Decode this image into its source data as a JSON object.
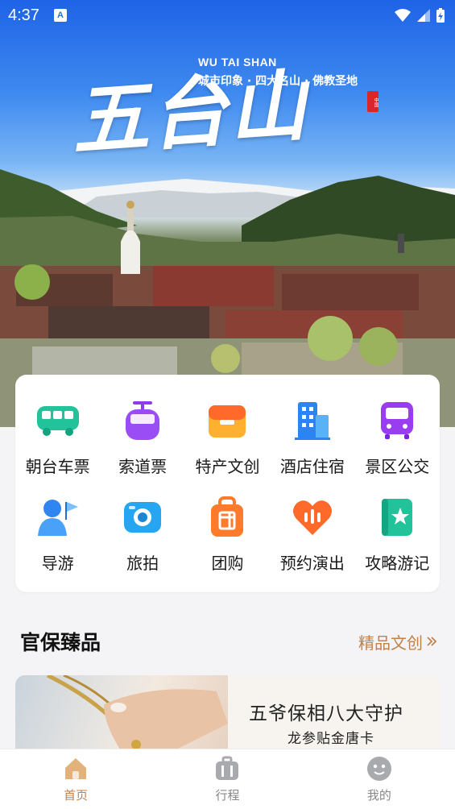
{
  "status_bar": {
    "time": "4:37",
    "notification_badge": "A"
  },
  "hero": {
    "title": "五台山",
    "english_title": "WU TAI SHAN",
    "subtitle": "城市印象 · 四大名山 · 佛教圣地",
    "seal_text": "中国"
  },
  "services": [
    {
      "label": "朝台车票",
      "icon": "bus-icon",
      "color": "#22c39a"
    },
    {
      "label": "索道票",
      "icon": "cable-car-icon",
      "color": "#8b3cf0"
    },
    {
      "label": "特产文创",
      "icon": "gift-box-icon",
      "color": "#ff7a2a"
    },
    {
      "label": "酒店住宿",
      "icon": "hotel-icon",
      "color": "#2b84f2"
    },
    {
      "label": "景区公交",
      "icon": "shuttle-bus-icon",
      "color": "#9a3cf0"
    },
    {
      "label": "导游",
      "icon": "guide-icon",
      "color": "#2f86f0"
    },
    {
      "label": "旅拍",
      "icon": "camera-icon",
      "color": "#26a6f0"
    },
    {
      "label": "团购",
      "icon": "group-buy-icon",
      "color": "#ff7a2a"
    },
    {
      "label": "预约演出",
      "icon": "heart-audio-icon",
      "color": "#ff6a2a"
    },
    {
      "label": "攻略游记",
      "icon": "star-book-icon",
      "color": "#22c39a"
    }
  ],
  "featured": {
    "title": "官保臻品",
    "more_label": "精品文创",
    "more_icon": "double-chevron-right-icon",
    "banner": {
      "headline": "五爷保相八大守护",
      "subline": "龙参贴金唐卡"
    }
  },
  "tabbar": [
    {
      "label": "首页",
      "icon": "home-icon",
      "active": true
    },
    {
      "label": "行程",
      "icon": "itinerary-icon",
      "active": false
    },
    {
      "label": "我的",
      "icon": "profile-icon",
      "active": false
    }
  ],
  "colors": {
    "accent": "#c0814a",
    "hero_sky": "#2b6fe6"
  }
}
